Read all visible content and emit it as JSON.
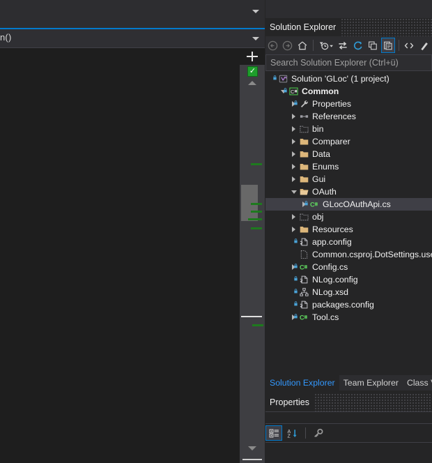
{
  "editor": {
    "nav_member_text": "n()",
    "top_dropdown_icon": "chevron-down-icon",
    "nav_dropdown_icon": "chevron-down-icon",
    "scrollbar": {
      "health_indicator": "✓",
      "splitter_icon": "split-view-icon",
      "scroll_up_icon": "arrow-up-icon",
      "scroll_down_icon": "arrow-down-icon",
      "change_marker_color": "#1e7a1e",
      "thumb_color": "#686868"
    }
  },
  "solution_explorer": {
    "title": "Solution Explorer",
    "search_placeholder": "Search Solution Explorer (Ctrl+ü)",
    "search_value": "",
    "toolbar": [
      {
        "name": "back-icon",
        "label": "Back",
        "enabled": false
      },
      {
        "name": "forward-icon",
        "label": "Forward",
        "enabled": false
      },
      {
        "name": "home-icon",
        "label": "Home",
        "enabled": true
      },
      {
        "name": "pending-changes-filter-icon",
        "label": "Pending Changes Filter",
        "enabled": true
      },
      {
        "name": "sync-with-active-document-icon",
        "label": "Sync with Active Document",
        "enabled": true
      },
      {
        "name": "refresh-icon",
        "label": "Refresh",
        "enabled": true
      },
      {
        "name": "collapse-all-icon",
        "label": "Collapse All",
        "enabled": true
      },
      {
        "name": "show-all-files-icon",
        "label": "Show All Files",
        "enabled": true,
        "selected": true
      },
      {
        "name": "view-code-icon",
        "label": "View Code",
        "enabled": true
      },
      {
        "name": "view-designer-icon",
        "label": "View Designer",
        "enabled": true
      }
    ],
    "tree": [
      {
        "label": "Solution 'GLoc' (1 project)",
        "indent": 0,
        "twisty": "none",
        "icon": "solution-icon",
        "bold": false,
        "locked": true,
        "selected": false
      },
      {
        "label": "Common",
        "indent": 1,
        "twisty": "open",
        "icon": "csharp-project-icon",
        "bold": true,
        "locked": true,
        "selected": false
      },
      {
        "label": "Properties",
        "indent": 2,
        "twisty": "closed",
        "icon": "wrench-icon",
        "bold": false,
        "locked": true,
        "selected": false
      },
      {
        "label": "References",
        "indent": 2,
        "twisty": "closed",
        "icon": "references-icon",
        "bold": false,
        "locked": false,
        "selected": false
      },
      {
        "label": "bin",
        "indent": 2,
        "twisty": "closed",
        "icon": "excluded-folder-icon",
        "bold": false,
        "locked": false,
        "selected": false
      },
      {
        "label": "Comparer",
        "indent": 2,
        "twisty": "closed",
        "icon": "folder-icon",
        "bold": false,
        "locked": false,
        "selected": false
      },
      {
        "label": "Data",
        "indent": 2,
        "twisty": "closed",
        "icon": "folder-icon",
        "bold": false,
        "locked": false,
        "selected": false
      },
      {
        "label": "Enums",
        "indent": 2,
        "twisty": "closed",
        "icon": "folder-icon",
        "bold": false,
        "locked": false,
        "selected": false
      },
      {
        "label": "Gui",
        "indent": 2,
        "twisty": "closed",
        "icon": "folder-icon",
        "bold": false,
        "locked": false,
        "selected": false
      },
      {
        "label": "OAuth",
        "indent": 2,
        "twisty": "open",
        "icon": "folder-open-icon",
        "bold": false,
        "locked": false,
        "selected": false
      },
      {
        "label": "GLocOAuthApi.cs",
        "indent": 3,
        "twisty": "closed",
        "icon": "csharp-file-icon",
        "bold": false,
        "locked": true,
        "selected": true
      },
      {
        "label": "obj",
        "indent": 2,
        "twisty": "closed",
        "icon": "excluded-folder-icon",
        "bold": false,
        "locked": false,
        "selected": false
      },
      {
        "label": "Resources",
        "indent": 2,
        "twisty": "closed",
        "icon": "folder-icon",
        "bold": false,
        "locked": false,
        "selected": false
      },
      {
        "label": "app.config",
        "indent": 2,
        "twisty": "none",
        "icon": "config-file-icon",
        "bold": false,
        "locked": true,
        "selected": false
      },
      {
        "label": "Common.csproj.DotSettings.user",
        "indent": 2,
        "twisty": "none",
        "icon": "excluded-file-icon",
        "bold": false,
        "locked": false,
        "selected": false
      },
      {
        "label": "Config.cs",
        "indent": 2,
        "twisty": "closed",
        "icon": "csharp-file-icon",
        "bold": false,
        "locked": true,
        "selected": false
      },
      {
        "label": "NLog.config",
        "indent": 2,
        "twisty": "none",
        "icon": "config-file-icon",
        "bold": false,
        "locked": true,
        "selected": false
      },
      {
        "label": "NLog.xsd",
        "indent": 2,
        "twisty": "none",
        "icon": "xsd-schema-icon",
        "bold": false,
        "locked": true,
        "selected": false
      },
      {
        "label": "packages.config",
        "indent": 2,
        "twisty": "none",
        "icon": "config-file-icon",
        "bold": false,
        "locked": true,
        "selected": false
      },
      {
        "label": "Tool.cs",
        "indent": 2,
        "twisty": "closed",
        "icon": "csharp-file-icon",
        "bold": false,
        "locked": true,
        "selected": false
      }
    ],
    "tabs": [
      {
        "label": "Solution Explorer",
        "active": true
      },
      {
        "label": "Team Explorer",
        "active": false
      },
      {
        "label": "Class View",
        "active": false
      }
    ]
  },
  "properties_panel": {
    "title": "Properties",
    "toolbar": [
      {
        "name": "categorized-view-icon",
        "label": "Categorized",
        "selected": true
      },
      {
        "name": "alphabetical-sort-icon",
        "label": "Alphabetical",
        "selected": false
      },
      {
        "name": "properties-key-icon",
        "label": "Properties",
        "selected": false
      }
    ]
  },
  "colors": {
    "accent": "#007acc",
    "active_tab_text": "#3399ff",
    "selection": "#3f3f46",
    "panel_bg": "#252526",
    "toolbar_bg": "#2d2d30",
    "editor_bg": "#1e1e1e",
    "change_marker": "#1e7a1e",
    "ok_indicator": "#1f9e2c",
    "folder": "#dcb67a"
  }
}
